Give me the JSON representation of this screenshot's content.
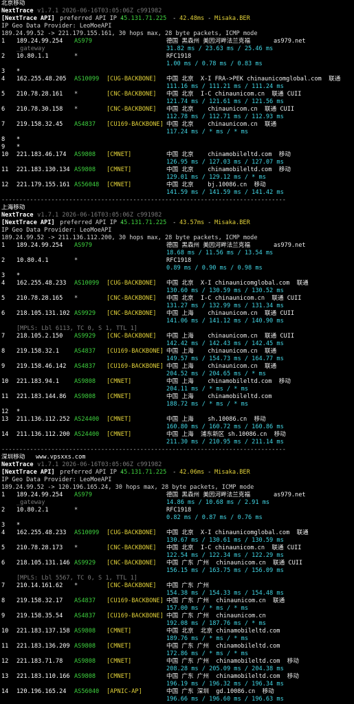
{
  "sections": [
    {
      "label": "北京移动",
      "header": {
        "app": "NextTrace",
        "version": " v1.7.1 2026-06-16T03:05:06Z c991982",
        "api_prefix": "[NextTrace API]",
        "api_text": " preferred API IP - ",
        "api_ip": "45.131.71.225",
        "api_sep": " - ",
        "api_ms": "42.48ms",
        "api_sep2": " - ",
        "api_loc": "Misaka.BER",
        "geo": "IP Geo Data Provider: LeoMoeAPI",
        "trace": "189.24.99.52 -> 221.179.155.161, 30 hops max, 28 byte packets, ICMP mode"
      },
      "rows": [
        {
          "n": "1",
          "ip": "189.24.99.254",
          "asn": "AS979",
          "tag": "",
          "geo": "德国 黑森州 美因河畔法兰克福",
          "isp": "as979.net"
        },
        {
          "n": "",
          "ip": "",
          "asn": "",
          "tag": "",
          "geo": "31.82 ms / 23.63 ms / 25.46 ms",
          "isp": "",
          "sub": "_gateway",
          "ms": true
        },
        {
          "n": "2",
          "ip": "10.80.1.1",
          "asn": "*",
          "tag": "",
          "geo": "RFC1918",
          "isp": ""
        },
        {
          "n": "",
          "ip": "",
          "asn": "",
          "tag": "",
          "geo": "1.00 ms / 0.78 ms / 0.83 ms",
          "isp": "",
          "ms": true
        },
        {
          "n": "3",
          "ip": "*",
          "asn": "",
          "tag": "",
          "geo": "",
          "isp": ""
        },
        {
          "n": "4",
          "ip": "162.255.48.205",
          "asn": "AS10099",
          "tag": "[CUG-BACKBONE]",
          "geo": "中国 北京  X-I FRA->PEK chinaunicomglobal.com  联通",
          "isp": ""
        },
        {
          "n": "",
          "ip": "",
          "asn": "",
          "tag": "",
          "geo": "111.16 ms / 111.21 ms / 111.24 ms",
          "isp": "",
          "ms": true
        },
        {
          "n": "5",
          "ip": "210.78.28.161",
          "asn": "*",
          "tag": "[CNC-BACKBONE]",
          "geo": "中国 北京  I-C chinaunicom.cn  联通 CUII",
          "isp": ""
        },
        {
          "n": "",
          "ip": "",
          "asn": "",
          "tag": "",
          "geo": "121.74 ms / 121.61 ms / 121.56 ms",
          "isp": "",
          "ms": true
        },
        {
          "n": "6",
          "ip": "210.78.30.158",
          "asn": "*",
          "tag": "[CNC-BACKBONE]",
          "geo": "中国 北京    chinaunicom.cn  联通 CUII",
          "isp": ""
        },
        {
          "n": "",
          "ip": "",
          "asn": "",
          "tag": "",
          "geo": "112.78 ms / 112.71 ms / 112.93 ms",
          "isp": "",
          "ms": true
        },
        {
          "n": "7",
          "ip": "219.158.32.45",
          "asn": "AS4837",
          "tag": "[CU169-BACKBONE]",
          "geo": "中国 北京    chinaunicom.cn  联通",
          "isp": ""
        },
        {
          "n": "",
          "ip": "",
          "asn": "",
          "tag": "",
          "geo": "117.24 ms / * ms / * ms",
          "isp": "",
          "ms": true
        },
        {
          "n": "8",
          "ip": "*",
          "asn": "",
          "tag": "",
          "geo": "",
          "isp": ""
        },
        {
          "n": "9",
          "ip": "*",
          "asn": "",
          "tag": "",
          "geo": "",
          "isp": ""
        },
        {
          "n": "10",
          "ip": "221.183.46.174",
          "asn": "AS9808",
          "tag": "[CMNET]",
          "geo": "中国 北京    chinamobileltd.com  移动",
          "isp": ""
        },
        {
          "n": "",
          "ip": "",
          "asn": "",
          "tag": "",
          "geo": "126.95 ms / 127.03 ms / 127.07 ms",
          "isp": "",
          "ms": true
        },
        {
          "n": "11",
          "ip": "221.183.130.134",
          "asn": "AS9808",
          "tag": "[CMNET]",
          "geo": "中国 北京    chinamobileltd.com  移动",
          "isp": ""
        },
        {
          "n": "",
          "ip": "",
          "asn": "",
          "tag": "",
          "geo": "129.01 ms / 129.12 ms / * ms",
          "isp": "",
          "ms": true
        },
        {
          "n": "12",
          "ip": "221.179.155.161",
          "asn": "AS56048",
          "tag": "[CMNET]",
          "geo": "中国 北京    bj.10086.cn  移动",
          "isp": ""
        },
        {
          "n": "",
          "ip": "",
          "asn": "",
          "tag": "",
          "geo": "141.59 ms / 141.59 ms / 141.42 ms",
          "isp": "",
          "ms": true
        }
      ]
    },
    {
      "label": "上海移动",
      "header": {
        "app": "NextTrace",
        "version": " v1.7.1 2026-06-16T03:05:06Z c991982",
        "api_prefix": "[NextTrace API]",
        "api_text": " preferred API IP - ",
        "api_ip": "45.131.71.225",
        "api_sep": " - ",
        "api_ms": "43.57ms",
        "api_sep2": " - ",
        "api_loc": "Misaka.BER",
        "geo": "IP Geo Data Provider: LeoMoeAPI",
        "trace": "189.24.99.52 -> 211.136.112.200, 30 hops max, 28 byte packets, ICMP mode"
      },
      "rows": [
        {
          "n": "1",
          "ip": "189.24.99.254",
          "asn": "AS979",
          "tag": "",
          "geo": "德国 黑森州 美因河畔法兰克福",
          "isp": "as979.net"
        },
        {
          "n": "",
          "ip": "",
          "asn": "",
          "tag": "",
          "geo": "18.68 ms / 11.56 ms / 13.54 ms",
          "isp": "",
          "ms": true
        },
        {
          "n": "2",
          "ip": "10.80.4.1",
          "asn": "*",
          "tag": "",
          "geo": "RFC1918",
          "isp": ""
        },
        {
          "n": "",
          "ip": "",
          "asn": "",
          "tag": "",
          "geo": "0.89 ms / 0.90 ms / 0.98 ms",
          "isp": "",
          "ms": true
        },
        {
          "n": "3",
          "ip": "*",
          "asn": "",
          "tag": "",
          "geo": "",
          "isp": ""
        },
        {
          "n": "4",
          "ip": "162.255.48.233",
          "asn": "AS10099",
          "tag": "[CUG-BACKBONE]",
          "geo": "中国 北京  X-I chinaunicomglobal.com  联通",
          "isp": ""
        },
        {
          "n": "",
          "ip": "",
          "asn": "",
          "tag": "",
          "geo": "130.60 ms / 130.59 ms / 130.52 ms",
          "isp": "",
          "ms": true
        },
        {
          "n": "5",
          "ip": "210.78.28.165",
          "asn": "*",
          "tag": "[CNC-BACKBONE]",
          "geo": "中国 北京  I-C chinaunicom.cn  联通 CUII",
          "isp": ""
        },
        {
          "n": "",
          "ip": "",
          "asn": "",
          "tag": "",
          "geo": "131.27 ms / 132.99 ms / 131.34 ms",
          "isp": "",
          "ms": true
        },
        {
          "n": "6",
          "ip": "218.105.131.102",
          "asn": "AS9929",
          "tag": "[CNC-BACKBONE]",
          "geo": "中国 上海    chinaunicom.cn  联通 CUII",
          "isp": ""
        },
        {
          "n": "",
          "ip": "",
          "asn": "",
          "tag": "",
          "geo": "141.06 ms / 141.12 ms / 140.90 ms",
          "isp": "",
          "ms": true
        },
        {
          "n": "",
          "ip": "",
          "asn": "",
          "tag": "",
          "geo": "",
          "isp": "",
          "mpls": "[MPLS: Lbl 6113, TC 0, S 1, TTL 1]"
        },
        {
          "n": "7",
          "ip": "218.105.2.150",
          "asn": "AS9929",
          "tag": "[CNC-BACKBONE]",
          "geo": "中国 上海    chinaunicom.cn  联通 CUII",
          "isp": ""
        },
        {
          "n": "",
          "ip": "",
          "asn": "",
          "tag": "",
          "geo": "142.42 ms / 142.43 ms / 142.45 ms",
          "isp": "",
          "ms": true
        },
        {
          "n": "8",
          "ip": "219.158.32.1",
          "asn": "AS4837",
          "tag": "[CU169-BACKBONE]",
          "geo": "中国 上海    chinaunicom.cn  联通",
          "isp": ""
        },
        {
          "n": "",
          "ip": "",
          "asn": "",
          "tag": "",
          "geo": "149.57 ms / 154.73 ms / 164.77 ms",
          "isp": "",
          "ms": true
        },
        {
          "n": "9",
          "ip": "219.158.46.142",
          "asn": "AS4837",
          "tag": "[CU169-BACKBONE]",
          "geo": "中国 上海    chinaunicom.cn  联通",
          "isp": ""
        },
        {
          "n": "",
          "ip": "",
          "asn": "",
          "tag": "",
          "geo": "204.52 ms / 204.65 ms / * ms",
          "isp": "",
          "ms": true
        },
        {
          "n": "10",
          "ip": "221.183.94.1",
          "asn": "AS9808",
          "tag": "[CMNET]",
          "geo": "中国 上海    chinamobileltd.com  移动",
          "isp": ""
        },
        {
          "n": "",
          "ip": "",
          "asn": "",
          "tag": "",
          "geo": "204.11 ms / * ms / * ms",
          "isp": "",
          "ms": true
        },
        {
          "n": "11",
          "ip": "221.183.144.86",
          "asn": "AS9808",
          "tag": "[CMNET]",
          "geo": "中国 上海    chinamobileltd.com",
          "isp": ""
        },
        {
          "n": "",
          "ip": "",
          "asn": "",
          "tag": "",
          "geo": "188.72 ms / * ms / * ms",
          "isp": "",
          "ms": true
        },
        {
          "n": "12",
          "ip": "*",
          "asn": "",
          "tag": "",
          "geo": "",
          "isp": ""
        },
        {
          "n": "13",
          "ip": "211.136.112.252",
          "asn": "AS24400",
          "tag": "[CMNET]",
          "geo": "中国 上海    sh.10086.cn  移动",
          "isp": ""
        },
        {
          "n": "",
          "ip": "",
          "asn": "",
          "tag": "",
          "geo": "160.80 ms / 160.72 ms / 160.86 ms",
          "isp": "",
          "ms": true
        },
        {
          "n": "14",
          "ip": "211.136.112.200",
          "asn": "AS24400",
          "tag": "[CMNET]",
          "geo": "中国 上海  浦东新区 sh.10086.cn  移动",
          "isp": ""
        },
        {
          "n": "",
          "ip": "",
          "asn": "",
          "tag": "",
          "geo": "211.30 ms / 210.95 ms / 211.14 ms",
          "isp": "",
          "ms": true
        }
      ]
    },
    {
      "label": "深圳移动",
      "url": "www.vpsxxs.com",
      "header": {
        "app": "NextTrace",
        "version": " v1.7.1 2026-06-16T03:05:06Z c991982",
        "api_prefix": "[NextTrace API]",
        "api_text": " preferred API IP - ",
        "api_ip": "45.131.71.225",
        "api_sep": " - ",
        "api_ms": "42.06ms",
        "api_sep2": " - ",
        "api_loc": "Misaka.BER",
        "geo": "IP Geo Data Provider: LeoMoeAPI",
        "trace": "189.24.99.52 -> 120.196.165.24, 30 hops max, 28 byte packets, ICMP mode"
      },
      "rows": [
        {
          "n": "1",
          "ip": "189.24.99.254",
          "asn": "AS979",
          "tag": "",
          "geo": "德国 黑森州 美因河畔法兰克福",
          "isp": "as979.net"
        },
        {
          "n": "",
          "ip": "",
          "asn": "",
          "tag": "",
          "geo": "14.86 ms / 10.68 ms / 2.91 ms",
          "isp": "",
          "sub": "_gateway",
          "ms": true
        },
        {
          "n": "2",
          "ip": "10.80.2.1",
          "asn": "*",
          "tag": "",
          "geo": "RFC1918",
          "isp": ""
        },
        {
          "n": "",
          "ip": "",
          "asn": "",
          "tag": "",
          "geo": "0.82 ms / 0.87 ms / 0.76 ms",
          "isp": "",
          "ms": true
        },
        {
          "n": "3",
          "ip": "*",
          "asn": "",
          "tag": "",
          "geo": "",
          "isp": ""
        },
        {
          "n": "4",
          "ip": "162.255.48.233",
          "asn": "AS10099",
          "tag": "[CUG-BACKBONE]",
          "geo": "中国 北京  X-I chinaunicomglobal.com  联通",
          "isp": ""
        },
        {
          "n": "",
          "ip": "",
          "asn": "",
          "tag": "",
          "geo": "130.67 ms / 130.61 ms / 130.59 ms",
          "isp": "",
          "ms": true
        },
        {
          "n": "5",
          "ip": "210.78.28.173",
          "asn": "*",
          "tag": "[CNC-BACKBONE]",
          "geo": "中国 北京  I-C chinaunicom.cn  联通 CUII",
          "isp": ""
        },
        {
          "n": "",
          "ip": "",
          "asn": "",
          "tag": "",
          "geo": "122.54 ms / 122.34 ms / 122.29 ms",
          "isp": "",
          "ms": true
        },
        {
          "n": "6",
          "ip": "218.105.131.146",
          "asn": "AS9929",
          "tag": "[CNC-BACKBONE]",
          "geo": "中国 广东 广州  chinaunicom.cn  联通 CUII",
          "isp": ""
        },
        {
          "n": "",
          "ip": "",
          "asn": "",
          "tag": "",
          "geo": "156.15 ms / 163.75 ms / 156.09 ms",
          "isp": "",
          "ms": true
        },
        {
          "n": "",
          "ip": "",
          "asn": "",
          "tag": "",
          "geo": "",
          "isp": "",
          "mpls": "[MPLS: Lbl 5567, TC 0, S 1, TTL 1]"
        },
        {
          "n": "7",
          "ip": "210.14.161.62",
          "asn": "*",
          "tag": "[CNC-BACKBONE]",
          "geo": "中国 广东 广州",
          "isp": ""
        },
        {
          "n": "",
          "ip": "",
          "asn": "",
          "tag": "",
          "geo": "154.38 ms / 154.33 ms / 154.48 ms",
          "isp": "",
          "ms": true
        },
        {
          "n": "8",
          "ip": "219.158.32.17",
          "asn": "AS4837",
          "tag": "[CU169-BACKBONE]",
          "geo": "中国 广东 广州  chinaunicom.cn  联通",
          "isp": ""
        },
        {
          "n": "",
          "ip": "",
          "asn": "",
          "tag": "",
          "geo": "157.00 ms / * ms / * ms",
          "isp": "",
          "ms": true
        },
        {
          "n": "9",
          "ip": "219.158.35.54",
          "asn": "AS4837",
          "tag": "[CU169-BACKBONE]",
          "geo": "中国 广东 广州  chinaunicom.cn",
          "isp": ""
        },
        {
          "n": "",
          "ip": "",
          "asn": "",
          "tag": "",
          "geo": "192.08 ms / 187.76 ms / * ms",
          "isp": "",
          "ms": true
        },
        {
          "n": "10",
          "ip": "221.183.137.158",
          "asn": "AS9808",
          "tag": "[CMNET]",
          "geo": "中国 北京  北京 chinamobileltd.com",
          "isp": ""
        },
        {
          "n": "",
          "ip": "",
          "asn": "",
          "tag": "",
          "geo": "189.76 ms / * ms / * ms",
          "isp": "",
          "ms": true
        },
        {
          "n": "11",
          "ip": "221.183.136.209",
          "asn": "AS9808",
          "tag": "[CMNET]",
          "geo": "中国 广东 广州  chinamobileltd.com",
          "isp": ""
        },
        {
          "n": "",
          "ip": "",
          "asn": "",
          "tag": "",
          "geo": "172.86 ms / * ms / * ms",
          "isp": "",
          "ms": true
        },
        {
          "n": "12",
          "ip": "221.183.71.78",
          "asn": "AS9808",
          "tag": "[CMNET]",
          "geo": "中国 广东 广州  chinamobileltd.com  移动",
          "isp": ""
        },
        {
          "n": "",
          "ip": "",
          "asn": "",
          "tag": "",
          "geo": "208.28 ms / 205.09 ms / 204.38 ms",
          "isp": "",
          "ms": true
        },
        {
          "n": "13",
          "ip": "221.183.110.166",
          "asn": "AS9808",
          "tag": "[CMNET]",
          "geo": "中国 广东 广州  chinamobileltd.com  移动",
          "isp": ""
        },
        {
          "n": "",
          "ip": "",
          "asn": "",
          "tag": "",
          "geo": "196.19 ms / 196.32 ms / 196.34 ms",
          "isp": "",
          "ms": true
        },
        {
          "n": "14",
          "ip": "120.196.165.24",
          "asn": "AS56040",
          "tag": "[APNIC-AP]",
          "geo": "中国 广东 深圳  gd.10086.cn  移动",
          "isp": ""
        },
        {
          "n": "",
          "ip": "",
          "asn": "",
          "tag": "",
          "geo": "196.66 ms / 196.60 ms / 196.63 ms",
          "isp": "",
          "ms": true
        }
      ]
    }
  ],
  "separator": "--------------------------------------------------------------------------------",
  "colors": {
    "asn": "#3fd33f",
    "tag": "#e2d23a",
    "api_ip": "#3fd33f",
    "api_ms": "#e2d23a",
    "api_loc": "#e2d23a",
    "text": "#d6d6d6",
    "bg": "#000000"
  }
}
